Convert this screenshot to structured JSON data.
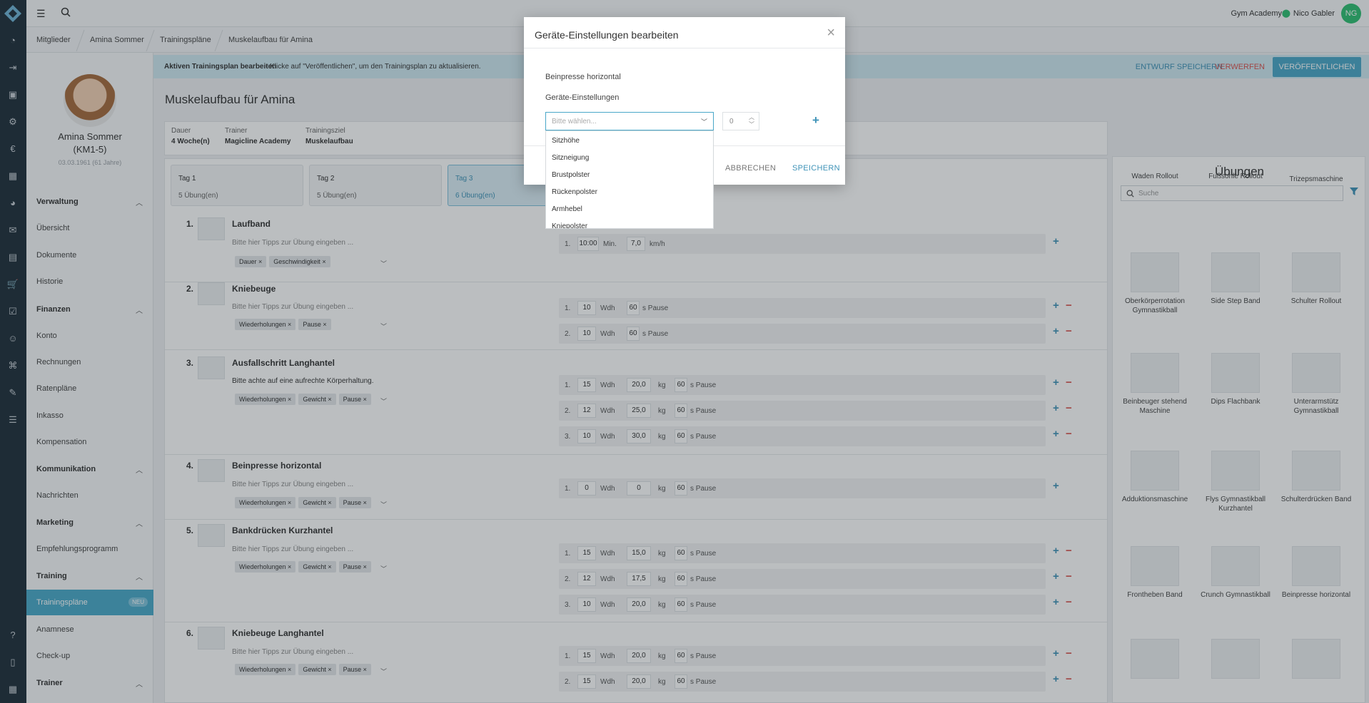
{
  "topbar": {
    "studio": "Gym Academy",
    "user_name": "Nico Gabler",
    "user_initials": "NG"
  },
  "breadcrumbs": [
    "Mitglieder",
    "Amina Sommer",
    "Trainingspläne",
    "Muskelaufbau für Amina"
  ],
  "member": {
    "name": "Amina Sommer",
    "id": "(KM1-5)",
    "dob": "03.03.1961 (61 Jahre)"
  },
  "nav": {
    "sections": [
      {
        "title": "Verwaltung",
        "items": [
          "Übersicht",
          "Dokumente",
          "Historie"
        ]
      },
      {
        "title": "Finanzen",
        "items": [
          "Konto",
          "Rechnungen",
          "Ratenpläne",
          "Inkasso",
          "Kompensation"
        ]
      },
      {
        "title": "Kommunikation",
        "items": [
          "Nachrichten"
        ]
      },
      {
        "title": "Marketing",
        "items": [
          "Empfehlungsprogramm"
        ]
      },
      {
        "title": "Training",
        "items": [
          "Trainingspläne",
          "Anamnese",
          "Check-up"
        ]
      },
      {
        "title": "Trainer",
        "items": []
      }
    ],
    "active_item": "Trainingspläne",
    "active_badge": "NEU"
  },
  "editbar": {
    "bold": "Aktiven Trainingsplan bearbeiten",
    "message": "-  Klicke auf \"Veröffentlichen\", um den Trainingsplan zu aktualisieren.",
    "draft": "ENTWURF SPEICHERN",
    "discard": "VERWERFEN",
    "publish": "VERÖFFENTLICHEN"
  },
  "plan": {
    "title": "Muskelaufbau für Amina",
    "info": [
      {
        "label": "Dauer",
        "value": "4 Woche(n)"
      },
      {
        "label": "Trainer",
        "value": "Magicline Academy"
      },
      {
        "label": "Trainingsziel",
        "value": "Muskelaufbau"
      }
    ],
    "days": [
      {
        "title": "Tag 1",
        "sub": "5 Übung(en)"
      },
      {
        "title": "Tag 2",
        "sub": "5 Übung(en)"
      },
      {
        "title": "Tag 3",
        "sub": "6 Übung(en)"
      }
    ]
  },
  "exercises": [
    {
      "num": "1.",
      "name": "Laufband",
      "tip": "Bitte hier Tipps zur Übung eingeben ...",
      "tags": [
        "Dauer",
        "Geschwindigkeit"
      ],
      "sets": [
        {
          "n": "1.",
          "a": "10:00",
          "au": "Min.",
          "b": "7,0",
          "bu": "km/h"
        }
      ]
    },
    {
      "num": "2.",
      "name": "Kniebeuge",
      "tip": "Bitte hier Tipps zur Übung eingeben ...",
      "tags": [
        "Wiederholungen",
        "Pause"
      ],
      "sets": [
        {
          "n": "1.",
          "a": "10",
          "au": "Wdh",
          "c": "60",
          "cu": "s Pause"
        },
        {
          "n": "2.",
          "a": "10",
          "au": "Wdh",
          "c": "60",
          "cu": "s Pause"
        }
      ]
    },
    {
      "num": "3.",
      "name": "Ausfallschritt Langhantel",
      "tip": "Bitte achte auf eine aufrechte Körperhaltung.",
      "tags": [
        "Wiederholungen",
        "Gewicht",
        "Pause"
      ],
      "sets": [
        {
          "n": "1.",
          "a": "15",
          "au": "Wdh",
          "b": "20,0",
          "bu": "kg",
          "c": "60",
          "cu": "s Pause"
        },
        {
          "n": "2.",
          "a": "12",
          "au": "Wdh",
          "b": "25,0",
          "bu": "kg",
          "c": "60",
          "cu": "s Pause"
        },
        {
          "n": "3.",
          "a": "10",
          "au": "Wdh",
          "b": "30,0",
          "bu": "kg",
          "c": "60",
          "cu": "s Pause"
        }
      ]
    },
    {
      "num": "4.",
      "name": "Beinpresse horizontal",
      "tip": "Bitte hier Tipps zur Übung eingeben ...",
      "tags": [
        "Wiederholungen",
        "Gewicht",
        "Pause"
      ],
      "sets": [
        {
          "n": "1.",
          "a": "0",
          "au": "Wdh",
          "b": "0",
          "bu": "kg",
          "c": "60",
          "cu": "s Pause"
        }
      ]
    },
    {
      "num": "5.",
      "name": "Bankdrücken Kurzhantel",
      "tip": "Bitte hier Tipps zur Übung eingeben ...",
      "tags": [
        "Wiederholungen",
        "Gewicht",
        "Pause"
      ],
      "sets": [
        {
          "n": "1.",
          "a": "15",
          "au": "Wdh",
          "b": "15,0",
          "bu": "kg",
          "c": "60",
          "cu": "s Pause"
        },
        {
          "n": "2.",
          "a": "12",
          "au": "Wdh",
          "b": "17,5",
          "bu": "kg",
          "c": "60",
          "cu": "s Pause"
        },
        {
          "n": "3.",
          "a": "10",
          "au": "Wdh",
          "b": "20,0",
          "bu": "kg",
          "c": "60",
          "cu": "s Pause"
        }
      ]
    },
    {
      "num": "6.",
      "name": "Kniebeuge Langhantel",
      "tip": "Bitte hier Tipps zur Übung eingeben ...",
      "tags": [
        "Wiederholungen",
        "Gewicht",
        "Pause"
      ],
      "sets": [
        {
          "n": "1.",
          "a": "15",
          "au": "Wdh",
          "b": "20,0",
          "bu": "kg",
          "c": "60",
          "cu": "s Pause"
        },
        {
          "n": "2.",
          "a": "15",
          "au": "Wdh",
          "b": "20,0",
          "bu": "kg",
          "c": "60",
          "cu": "s Pause"
        }
      ]
    }
  ],
  "library": {
    "title": "Übungen",
    "search_placeholder": "Suche",
    "top_row": [
      "Waden Rollout",
      "Fußsohle Rollout",
      "Trizepsmaschine"
    ],
    "cards": [
      [
        "Oberkörperrotation Gymnastikball",
        "Side Step Band",
        "Schulter Rollout"
      ],
      [
        "Beinbeuger stehend Maschine",
        "Dips Flachbank",
        "Unterarmstütz Gymnastikball"
      ],
      [
        "Adduktionsmaschine",
        "Flys Gymnastikball Kurzhantel",
        "Schulterdrücken Band"
      ],
      [
        "Frontheben Band",
        "Crunch Gymnastikball",
        "Beinpresse horizontal"
      ]
    ]
  },
  "modal": {
    "title": "Geräte-Einstellungen bearbeiten",
    "device": "Beinpresse horizontal",
    "label": "Geräte-Einstellungen",
    "select_placeholder": "Bitte wählen...",
    "number_value": "0",
    "cancel": "ABBRECHEN",
    "save": "SPEICHERN",
    "options": [
      "Sitzhöhe",
      "Sitzneigung",
      "Brustpolster",
      "Rückenpolster",
      "Armhebel",
      "Kniepolster"
    ]
  }
}
